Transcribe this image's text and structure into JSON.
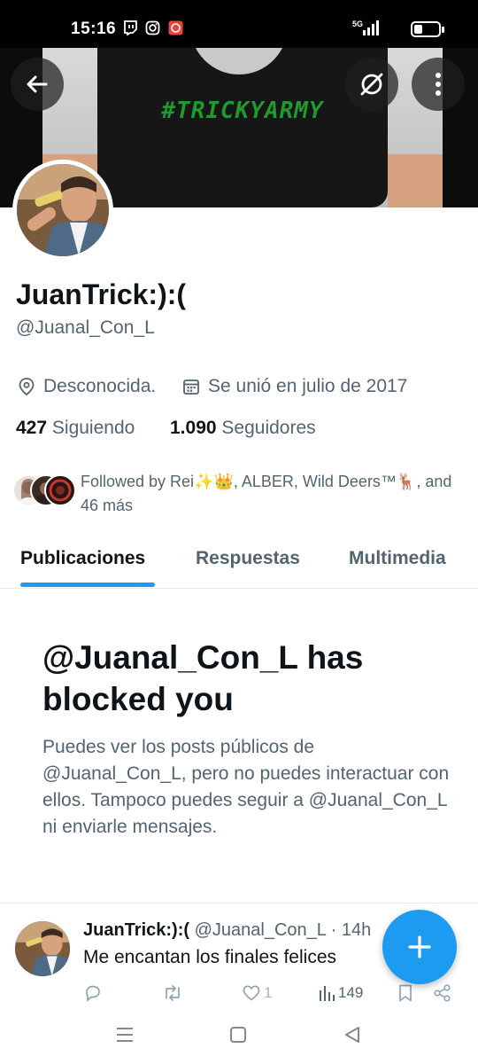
{
  "status_bar": {
    "time": "15:16",
    "network": "5G",
    "battery_level": 0.35,
    "icons": [
      "twitch-icon",
      "instagram-icon",
      "app-icon"
    ]
  },
  "banner": {
    "shirt_text": "#TRICKYARMY"
  },
  "header_buttons": {
    "back": "back-arrow-icon",
    "grok": "grok-icon",
    "more": "more-vertical-icon"
  },
  "profile": {
    "display_name": "JuanTrick:):(",
    "handle": "@Juanal_Con_L",
    "location": "Desconocida.",
    "joined": "Se unió en julio de 2017",
    "following_count": "427",
    "following_label": "Siguiendo",
    "followers_count": "1.090",
    "followers_label": "Seguidores",
    "followed_by": "Followed by Rei✨👑, ALBER, Wild Deers™🦌, and 46 más"
  },
  "tabs": [
    {
      "label": "Publicaciones",
      "active": true
    },
    {
      "label": "Respuestas",
      "active": false
    },
    {
      "label": "Multimedia",
      "active": false
    }
  ],
  "blocked": {
    "title": "@Juanal_Con_L has blocked you",
    "description": "Puedes ver los posts públicos de @Juanal_Con_L, pero no puedes interactuar con ellos. Tampoco puedes seguir a @Juanal_Con_L ni enviarle mensajes."
  },
  "post": {
    "name": "JuanTrick:):(",
    "handle": "@Juanal_Con_L",
    "time": "· 14h",
    "text": "Me encantan los finales felices",
    "likes": "1",
    "views": "149"
  },
  "colors": {
    "accent": "#1d9bf0",
    "text_primary": "#0f1419",
    "text_secondary": "#536471"
  }
}
